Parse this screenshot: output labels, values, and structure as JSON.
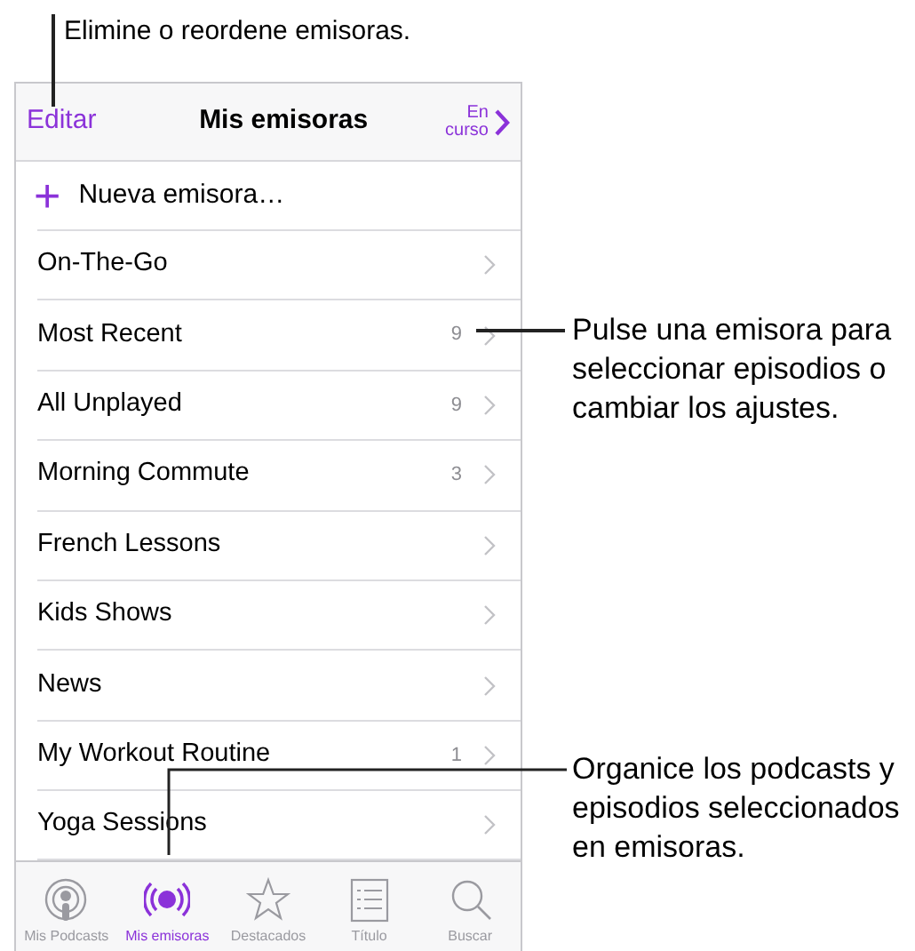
{
  "nav_bar": {
    "edit": "Editar",
    "title": "Mis emisoras",
    "now_playing": "En curso"
  },
  "new_station": {
    "icon": "+",
    "label": "Nueva emisora…"
  },
  "stations": [
    {
      "name": "On-The-Go"
    },
    {
      "name": "Most Recent",
      "count": "9"
    },
    {
      "name": "All Unplayed",
      "count": "9"
    },
    {
      "name": "Morning Commute",
      "count": "3"
    },
    {
      "name": "French Lessons"
    },
    {
      "name": "Kids Shows"
    },
    {
      "name": "News"
    },
    {
      "name": "My Workout Routine",
      "count": "1"
    },
    {
      "name": "Yoga Sessions"
    }
  ],
  "tab_bar": [
    {
      "kind": "podcasts",
      "label": "Mis Podcasts",
      "selected": false
    },
    {
      "kind": "stations",
      "label": "Mis emisoras",
      "selected": true
    },
    {
      "kind": "featured",
      "label": "Destacados",
      "selected": false
    },
    {
      "kind": "list",
      "label": "Título",
      "selected": false
    },
    {
      "kind": "search",
      "label": "Buscar",
      "selected": false
    }
  ],
  "callouts": [
    {
      "kind": "top",
      "text": "Elimine o reordene emisoras."
    },
    {
      "kind": "station",
      "text": "Pulse una emisora para seleccionar episodios o cambiar los ajustes."
    },
    {
      "kind": "tab",
      "text": "Organice los podcasts y episodios seleccionados en emisoras."
    }
  ]
}
